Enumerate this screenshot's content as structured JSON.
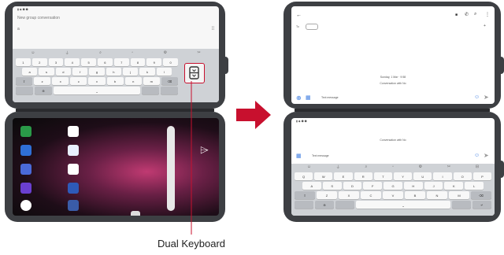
{
  "caption": "Dual Keyboard",
  "left_top": {
    "title": "New group conversation",
    "to_field": "a",
    "key_rows": [
      [
        "1",
        "2",
        "3",
        "4",
        "5",
        "6",
        "7",
        "8",
        "9",
        "0"
      ],
      [
        "a",
        "s",
        "d",
        "f",
        "g",
        "h",
        "j",
        "k",
        "l"
      ],
      [
        "z",
        "x",
        "c",
        "v",
        "b",
        "n",
        "m"
      ]
    ]
  },
  "right_top": {
    "compose_placeholder": "Text message",
    "to_field": "To",
    "date_label": "Sunday, 1 Mar · 9:58",
    "info_label": "Conversation with No"
  },
  "right_bottom": {
    "compose_placeholder": "Text message",
    "info_label": "Conversation with No",
    "key_rows": [
      [
        "Q",
        "W",
        "E",
        "R",
        "T",
        "Y",
        "U",
        "I",
        "O",
        "P"
      ],
      [
        "A",
        "S",
        "D",
        "F",
        "G",
        "H",
        "J",
        "K",
        "L"
      ],
      [
        "Z",
        "X",
        "C",
        "V",
        "B",
        "N",
        "M"
      ]
    ]
  },
  "colors": {
    "arrow": "#c8102e",
    "callout": "#c8102e",
    "accent": "#3b7be0"
  }
}
